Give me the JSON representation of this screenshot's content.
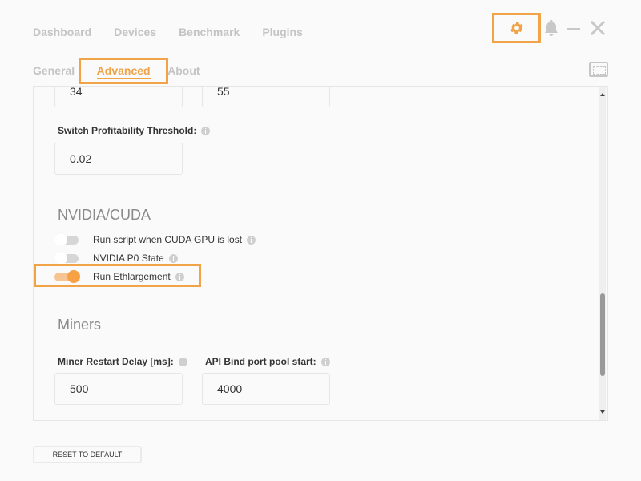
{
  "nav": {
    "items": [
      "Dashboard",
      "Devices",
      "Benchmark",
      "Plugins"
    ]
  },
  "window_controls": {
    "settings_icon": "gear-icon",
    "notifications_icon": "bell-icon",
    "minimize_icon": "minimize-icon",
    "close_icon": "close-icon"
  },
  "subtabs": {
    "general": "General",
    "advanced": "Advanced",
    "about": "About"
  },
  "colors": {
    "accent": "#f0a347",
    "toggle_on_knob": "#f7a144",
    "toggle_on_track": "#f7c592",
    "muted_text": "#c4c4c4"
  },
  "panel": {
    "top_inputs": [
      "34",
      "55"
    ],
    "switch_threshold": {
      "label": "Switch Profitability Threshold:",
      "value": "0.02"
    },
    "nvidia_section": {
      "title": "NVIDIA/CUDA",
      "toggles": [
        {
          "label": "Run script when CUDA GPU is lost",
          "on": false
        },
        {
          "label": "NVIDIA P0 State",
          "on": false
        },
        {
          "label": "Run Ethlargement",
          "on": true
        }
      ]
    },
    "miners_section": {
      "title": "Miners",
      "restart_delay": {
        "label": "Miner Restart Delay [ms]:",
        "value": "500"
      },
      "api_bind_port": {
        "label": "API Bind port pool start:",
        "value": "4000"
      }
    }
  },
  "footer": {
    "reset_label": "RESET TO DEFAULT"
  }
}
